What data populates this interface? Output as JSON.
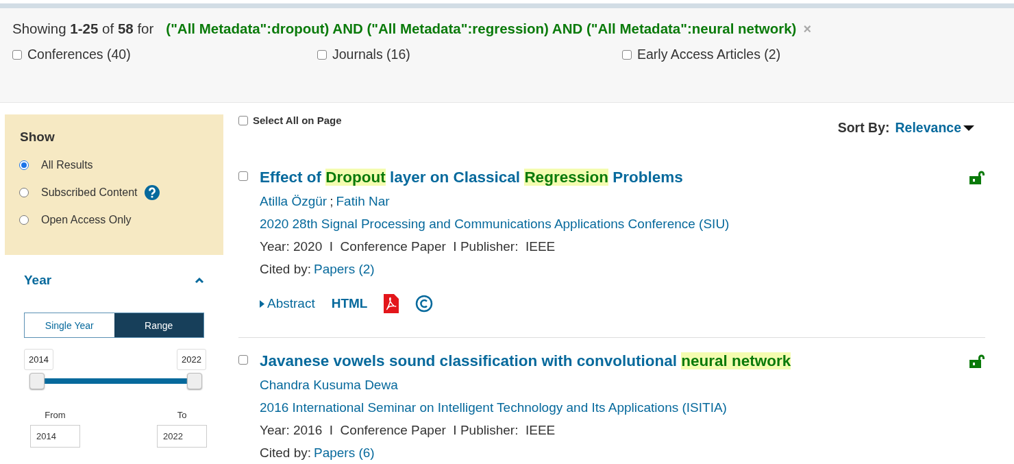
{
  "summary": {
    "text": "Showing **1-25** of **58** for",
    "query": "(\"All Metadata\":dropout) AND (\"All Metadata\":regression) AND (\"All Metadata\":neural network)",
    "clear": "×"
  },
  "content_types": [
    {
      "label": "Conferences (40)",
      "checked": false
    },
    {
      "label": "Journals (16)",
      "checked": false
    },
    {
      "label": "Early Access Articles (2)",
      "checked": false
    }
  ],
  "sidebar": {
    "show": {
      "title": "Show",
      "options": [
        {
          "label": "All Results",
          "selected": true,
          "help": false
        },
        {
          "label": "Subscribed Content",
          "selected": false,
          "help": true
        },
        {
          "label": "Open Access Only",
          "selected": false,
          "help": false
        }
      ]
    },
    "year": {
      "title": "Year",
      "expanded": true,
      "modes": [
        {
          "label": "Single Year",
          "selected": false
        },
        {
          "label": "Range",
          "selected": true
        }
      ],
      "min_label": "2014",
      "max_label": "2022",
      "thumbs": [
        {
          "level": 0
        },
        {
          "level": 1
        }
      ],
      "from_label": "From",
      "from_value": "2014",
      "to_label": "To",
      "to_value": "2022"
    }
  },
  "select_all": {
    "label": "Select All on Page",
    "checked": false
  },
  "sort": {
    "label": "Sort By:",
    "value": "Relevance"
  },
  "results": [
    {
      "checked": false,
      "title": [
        {
          "text": "Effect of ",
          "highlighted": false
        },
        {
          "text": "Dropout",
          "highlighted": true
        },
        {
          "text": " layer on Classical ",
          "highlighted": false
        },
        {
          "text": "Regression",
          "highlighted": true
        },
        {
          "text": " Problems",
          "highlighted": false
        }
      ],
      "authors": [
        "Atilla Özgür",
        "Fatih Nar"
      ],
      "author_separator": ";",
      "venue": "2020 28th Signal Processing and Communications Applications Conference (SIU)",
      "meta": "Year: 2020  I  Conference Paper  I Publisher:  IEEE",
      "cited_label": "Cited by:",
      "cited_link": "Papers (2)",
      "open_access": true,
      "actions": {
        "abstract": "Abstract",
        "html": "HTML",
        "pdf": true,
        "rights": true
      }
    },
    {
      "checked": false,
      "title": [
        {
          "text": "Javanese vowels sound classification with convolutional ",
          "highlighted": false
        },
        {
          "text": "neural",
          "highlighted": true
        },
        {
          "text": " network",
          "highlighted": true
        }
      ],
      "authors": [
        "Chandra Kusuma Dewa"
      ],
      "venue": "2016 International Seminar on Intelligent Technology and Its Applications (ISITIA)",
      "meta": "Year: 2016  I  Conference Paper  I Publisher:  IEEE",
      "cited_label": "Cited by:",
      "cited_link": "Papers (6)",
      "open_access": true
    }
  ]
}
